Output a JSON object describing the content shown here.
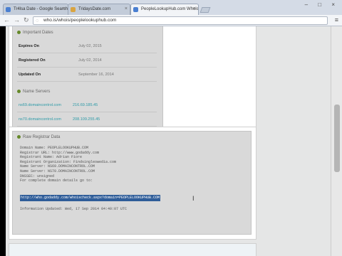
{
  "tabs": [
    {
      "title": "Tr4lsa Date - Google Search",
      "active": false,
      "icon_color": "#4a7fd1"
    },
    {
      "title": "TridaysDate.com",
      "active": false,
      "icon_color": "#d9a441"
    },
    {
      "title": "PeopleLookupHub.com Whois",
      "active": true,
      "icon_color": "#4a7fd1"
    }
  ],
  "window_controls": "– □ ×",
  "nav": {
    "back": "←",
    "forward": "→",
    "reload": "↻"
  },
  "url": "who.is/whois/peoplelookuphub.com",
  "menu_icon": "≡",
  "important_dates": {
    "title": "Important Dates",
    "rows": [
      {
        "label": "Expires On",
        "value": "July 02, 2015"
      },
      {
        "label": "Registered On",
        "value": "July 02, 2014"
      },
      {
        "label": "Updated On",
        "value": "September 16, 2014"
      }
    ]
  },
  "name_servers": {
    "title": "Name Servers",
    "rows": [
      {
        "host": "ns69.domaincontrol.com",
        "ip": "216.69.185.45"
      },
      {
        "host": "ns70.domaincontrol.com",
        "ip": "208.109.255.45"
      }
    ]
  },
  "raw_data": {
    "title": "Raw Registrar Data",
    "lines": [
      "Domain Name: PEOPLELOOKUPHUB.COM",
      "Registrar URL: http://www.godaddy.com",
      "Registrant Name: Adrian Fiore",
      "Registrant Organization: Findsingleowedia.com",
      "Name Server: NS69.DOMAINCONTROL.COM",
      "Name Server: NS70.DOMAINCONTROL.COM",
      "DNSSEC: unsigned",
      "",
      "For complete domain details go to:"
    ],
    "link": "http://who.godaddy.com/whoischeck.aspx?domain=PEOPLELOOKUPHUB.COM",
    "updated": "Information Updated: Wed, 17 Sep 2014 04:40:07 UTC"
  }
}
